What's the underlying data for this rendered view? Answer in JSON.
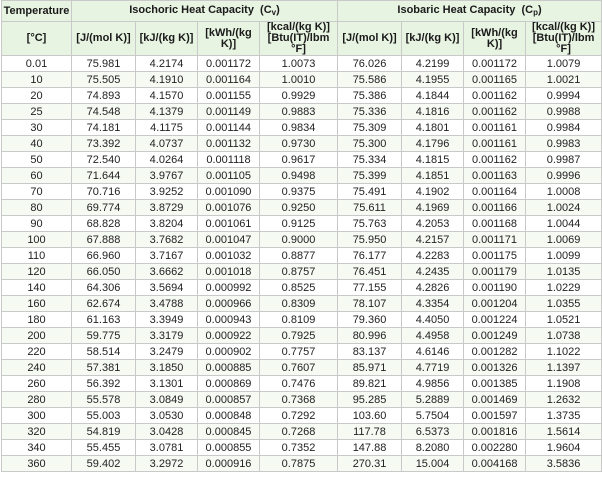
{
  "header": {
    "temperature": "Temperature",
    "isochoric_label": "Isochoric Heat Capacity",
    "isochoric_symbol": "C",
    "isochoric_sub": "v",
    "isobaric_label": "Isobaric Heat Capacity",
    "isobaric_symbol": "C",
    "isobaric_sub": "p",
    "units": {
      "temp": "[°C]",
      "j_mol_k": "[J/(mol K)]",
      "kj_kg_k": "[kJ/(kg K)]",
      "kwh_kg_k": "[kWh/(kg K)]",
      "kcal_btu": "[kcal/(kg K)] [Btu(IT)/lbm °F]"
    }
  },
  "rows": [
    [
      "0.01",
      "75.981",
      "4.2174",
      "0.001172",
      "1.0073",
      "76.026",
      "4.2199",
      "0.001172",
      "1.0079"
    ],
    [
      "10",
      "75.505",
      "4.1910",
      "0.001164",
      "1.0010",
      "75.586",
      "4.1955",
      "0.001165",
      "1.0021"
    ],
    [
      "20",
      "74.893",
      "4.1570",
      "0.001155",
      "0.9929",
      "75.386",
      "4.1844",
      "0.001162",
      "0.9994"
    ],
    [
      "25",
      "74.548",
      "4.1379",
      "0.001149",
      "0.9883",
      "75.336",
      "4.1816",
      "0.001162",
      "0.9988"
    ],
    [
      "30",
      "74.181",
      "4.1175",
      "0.001144",
      "0.9834",
      "75.309",
      "4.1801",
      "0.001161",
      "0.9984"
    ],
    [
      "40",
      "73.392",
      "4.0737",
      "0.001132",
      "0.9730",
      "75.300",
      "4.1796",
      "0.001161",
      "0.9983"
    ],
    [
      "50",
      "72.540",
      "4.0264",
      "0.001118",
      "0.9617",
      "75.334",
      "4.1815",
      "0.001162",
      "0.9987"
    ],
    [
      "60",
      "71.644",
      "3.9767",
      "0.001105",
      "0.9498",
      "75.399",
      "4.1851",
      "0.001163",
      "0.9996"
    ],
    [
      "70",
      "70.716",
      "3.9252",
      "0.001090",
      "0.9375",
      "75.491",
      "4.1902",
      "0.001164",
      "1.0008"
    ],
    [
      "80",
      "69.774",
      "3.8729",
      "0.001076",
      "0.9250",
      "75.611",
      "4.1969",
      "0.001166",
      "1.0024"
    ],
    [
      "90",
      "68.828",
      "3.8204",
      "0.001061",
      "0.9125",
      "75.763",
      "4.2053",
      "0.001168",
      "1.0044"
    ],
    [
      "100",
      "67.888",
      "3.7682",
      "0.001047",
      "0.9000",
      "75.950",
      "4.2157",
      "0.001171",
      "1.0069"
    ],
    [
      "110",
      "66.960",
      "3.7167",
      "0.001032",
      "0.8877",
      "76.177",
      "4.2283",
      "0.001175",
      "1.0099"
    ],
    [
      "120",
      "66.050",
      "3.6662",
      "0.001018",
      "0.8757",
      "76.451",
      "4.2435",
      "0.001179",
      "1.0135"
    ],
    [
      "140",
      "64.306",
      "3.5694",
      "0.000992",
      "0.8525",
      "77.155",
      "4.2826",
      "0.001190",
      "1.0229"
    ],
    [
      "160",
      "62.674",
      "3.4788",
      "0.000966",
      "0.8309",
      "78.107",
      "4.3354",
      "0.001204",
      "1.0355"
    ],
    [
      "180",
      "61.163",
      "3.3949",
      "0.000943",
      "0.8109",
      "79.360",
      "4.4050",
      "0.001224",
      "1.0521"
    ],
    [
      "200",
      "59.775",
      "3.3179",
      "0.000922",
      "0.7925",
      "80.996",
      "4.4958",
      "0.001249",
      "1.0738"
    ],
    [
      "220",
      "58.514",
      "3.2479",
      "0.000902",
      "0.7757",
      "83.137",
      "4.6146",
      "0.001282",
      "1.1022"
    ],
    [
      "240",
      "57.381",
      "3.1850",
      "0.000885",
      "0.7607",
      "85.971",
      "4.7719",
      "0.001326",
      "1.1397"
    ],
    [
      "260",
      "56.392",
      "3.1301",
      "0.000869",
      "0.7476",
      "89.821",
      "4.9856",
      "0.001385",
      "1.1908"
    ],
    [
      "280",
      "55.578",
      "3.0849",
      "0.000857",
      "0.7368",
      "95.285",
      "5.2889",
      "0.001469",
      "1.2632"
    ],
    [
      "300",
      "55.003",
      "3.0530",
      "0.000848",
      "0.7292",
      "103.60",
      "5.7504",
      "0.001597",
      "1.3735"
    ],
    [
      "320",
      "54.819",
      "3.0428",
      "0.000845",
      "0.7268",
      "117.78",
      "6.5373",
      "0.001816",
      "1.5614"
    ],
    [
      "340",
      "55.455",
      "3.0781",
      "0.000855",
      "0.7352",
      "147.88",
      "8.2080",
      "0.002280",
      "1.9604"
    ],
    [
      "360",
      "59.402",
      "3.2972",
      "0.000916",
      "0.7875",
      "270.31",
      "15.004",
      "0.004168",
      "3.5836"
    ]
  ]
}
